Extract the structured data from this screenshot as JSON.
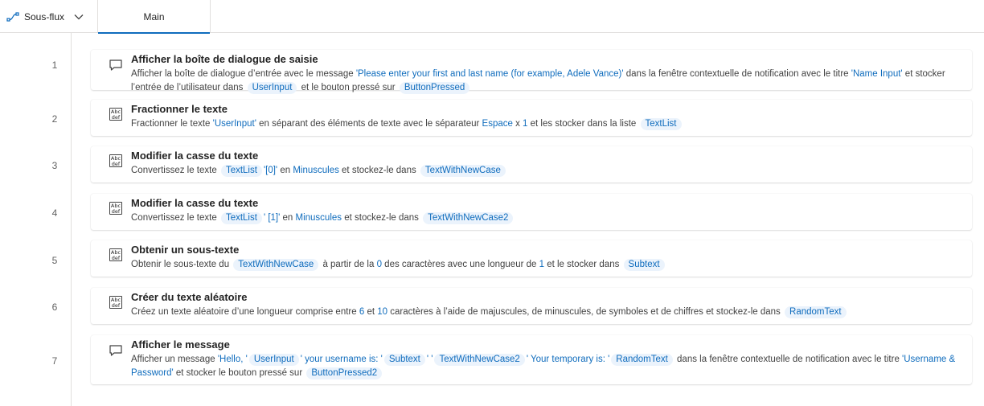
{
  "header": {
    "subflow_label": "Sous-flux",
    "main_tab_label": "Main"
  },
  "actions": [
    {
      "num": "1",
      "icon": "message-box-icon",
      "title": "Afficher la boîte de dialogue de saisie",
      "desc_parts": [
        {
          "t": "Afficher la boîte de dialogue d’entrée avec le message "
        },
        {
          "v": "'Please enter your first and last name (for example, Adele Vance)'"
        },
        {
          "t": " dans la fenêtre contextuelle de notification avec le titre "
        },
        {
          "v": "'Name Input'"
        },
        {
          "t": " et stocker l’entrée de l’utilisateur dans "
        },
        {
          "p": "UserInput"
        },
        {
          "t": " et le bouton pressé sur "
        },
        {
          "p": "ButtonPressed"
        }
      ]
    },
    {
      "num": "2",
      "icon": "abc-text-icon",
      "title": "Fractionner le texte",
      "desc_parts": [
        {
          "t": "Fractionner le texte "
        },
        {
          "v": "'UserInput'"
        },
        {
          "t": " en séparant des éléments de texte avec le séparateur "
        },
        {
          "v": "Espace"
        },
        {
          "t": " x "
        },
        {
          "v": "1"
        },
        {
          "t": " et les stocker dans la liste "
        },
        {
          "p": "TextList"
        }
      ]
    },
    {
      "num": "3",
      "icon": "abc-text-icon",
      "title": "Modifier la casse du texte",
      "desc_parts": [
        {
          "t": "Convertissez le texte "
        },
        {
          "p": "TextList"
        },
        {
          "v": "'[0]'"
        },
        {
          "t": " en "
        },
        {
          "v": "Minuscules"
        },
        {
          "t": " et stockez-le dans "
        },
        {
          "p": "TextWithNewCase"
        }
      ]
    },
    {
      "num": "4",
      "icon": "abc-text-icon",
      "title": "Modifier la casse du texte",
      "desc_parts": [
        {
          "t": "Convertissez le texte "
        },
        {
          "p": "TextList"
        },
        {
          "v": "' [1]'"
        },
        {
          "t": " en "
        },
        {
          "v": "Minuscules"
        },
        {
          "t": " et stockez-le dans "
        },
        {
          "p": "TextWithNewCase2"
        }
      ]
    },
    {
      "num": "5",
      "icon": "abc-text-icon",
      "title": "Obtenir un sous-texte",
      "desc_parts": [
        {
          "t": "Obtenir le sous-texte du "
        },
        {
          "p": "TextWithNewCase"
        },
        {
          "t": " à partir de la "
        },
        {
          "v": "0"
        },
        {
          "t": " des caractères avec une longueur de "
        },
        {
          "v": "1"
        },
        {
          "t": " et le stocker dans "
        },
        {
          "p": "Subtext"
        }
      ]
    },
    {
      "num": "6",
      "icon": "abc-text-icon",
      "title": "Créer du texte aléatoire",
      "desc_parts": [
        {
          "t": " Créez un texte aléatoire d’une longueur comprise entre "
        },
        {
          "v": "6"
        },
        {
          "t": " et "
        },
        {
          "v": "10"
        },
        {
          "t": " caractères à l’aide de majuscules, de minuscules, de symboles et de chiffres et stockez-le dans "
        },
        {
          "p": "RandomText"
        }
      ]
    },
    {
      "num": "7",
      "icon": "message-box-icon",
      "title": "Afficher le message",
      "desc_parts": [
        {
          "t": "Afficher un message "
        },
        {
          "v": "'Hello, '"
        },
        {
          "p": "UserInput"
        },
        {
          "v": "' your username is: '"
        },
        {
          "p": "Subtext"
        },
        {
          "v": "' '"
        },
        {
          "p": "TextWithNewCase2"
        },
        {
          "v": "' Your temporary is: '"
        },
        {
          "p": "RandomText"
        },
        {
          "t": " dans la fenêtre contextuelle de notification avec le titre "
        },
        {
          "v": "'Username & Password'"
        },
        {
          "t": " et stocker le bouton pressé sur "
        },
        {
          "p": "ButtonPressed2"
        }
      ]
    }
  ]
}
